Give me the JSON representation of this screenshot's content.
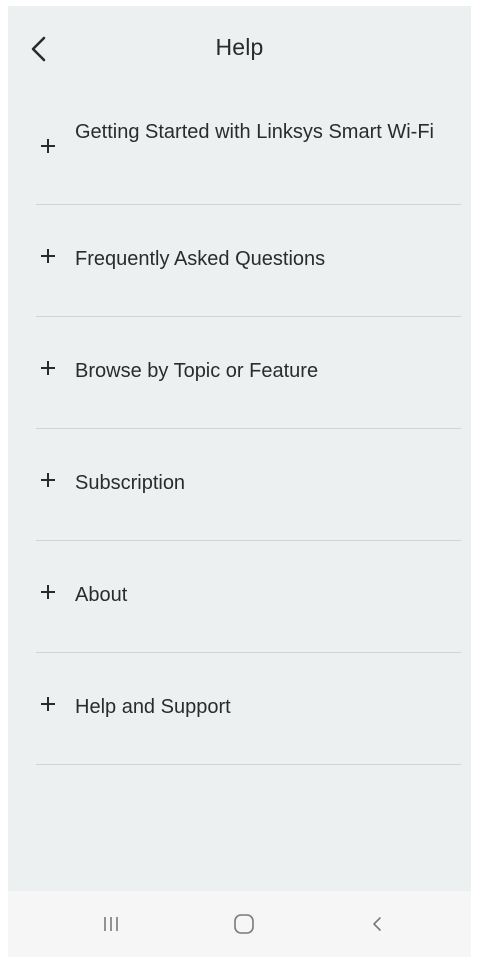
{
  "header": {
    "title": "Help",
    "back_icon": "chevron-left-icon"
  },
  "help_items": [
    {
      "label": "Getting Started with Linksys Smart Wi-Fi",
      "icon": "plus-icon"
    },
    {
      "label": "Frequently Asked Questions",
      "icon": "plus-icon"
    },
    {
      "label": "Browse by Topic or Feature",
      "icon": "plus-icon"
    },
    {
      "label": "Subscription",
      "icon": "plus-icon"
    },
    {
      "label": "About",
      "icon": "plus-icon"
    },
    {
      "label": "Help and Support",
      "icon": "plus-icon"
    }
  ],
  "system_nav": {
    "recent_icon": "recent-apps-icon",
    "home_icon": "home-icon",
    "back_icon": "back-icon"
  },
  "colors": {
    "background": "#edf0f1",
    "text": "#2b2b2b",
    "divider": "#cfd3d5",
    "navbar": "#f6f6f6"
  }
}
